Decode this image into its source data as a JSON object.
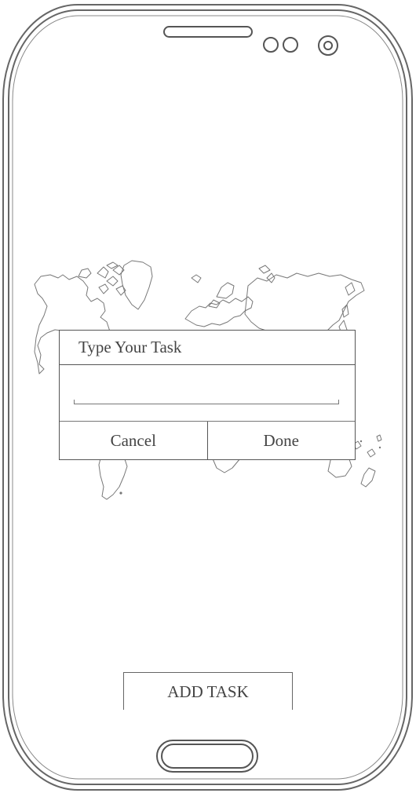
{
  "dialog": {
    "title": "Type Your Task",
    "input_value": "",
    "input_placeholder": "",
    "cancel_label": "Cancel",
    "done_label": "Done"
  },
  "main": {
    "add_task_label": "ADD TASK"
  },
  "icons": {
    "speaker": "earpiece-speaker-icon",
    "sensors": "proximity-sensor-icon",
    "camera": "front-camera-icon",
    "home": "home-button-icon",
    "background": "world-map-icon"
  },
  "colors": {
    "line": "#555555",
    "text": "#444444",
    "background": "#ffffff"
  }
}
